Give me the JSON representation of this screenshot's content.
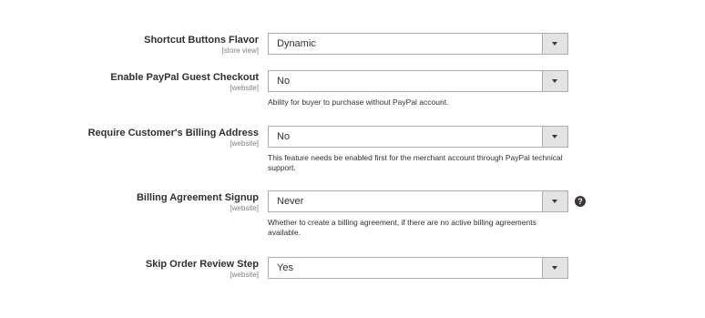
{
  "fields": [
    {
      "label": "Shortcut Buttons Flavor",
      "scope": "[store view]",
      "value": "Dynamic",
      "note": ""
    },
    {
      "label": "Enable PayPal Guest Checkout",
      "scope": "[website]",
      "value": "No",
      "note": "Ability for buyer to purchase without PayPal account."
    },
    {
      "label": "Require Customer's Billing Address",
      "scope": "[website]",
      "value": "No",
      "note": "This feature needs be enabled first for the merchant account through PayPal technical support."
    },
    {
      "label": "Billing Agreement Signup",
      "scope": "[website]",
      "value": "Never",
      "note": "Whether to create a billing agreement, if there are no active billing agreements available.",
      "help_glyph": "?"
    },
    {
      "label": "Skip Order Review Step",
      "scope": "[website]",
      "value": "Yes",
      "note": ""
    }
  ],
  "icons": {
    "select_arrow": "chevron-down-icon",
    "help": "question-circle-icon"
  },
  "colors": {
    "label": "#303030",
    "scope": "#808080",
    "border": "#adadad",
    "arrow_bg": "#e3e3e3",
    "arrow": "#41362f"
  }
}
